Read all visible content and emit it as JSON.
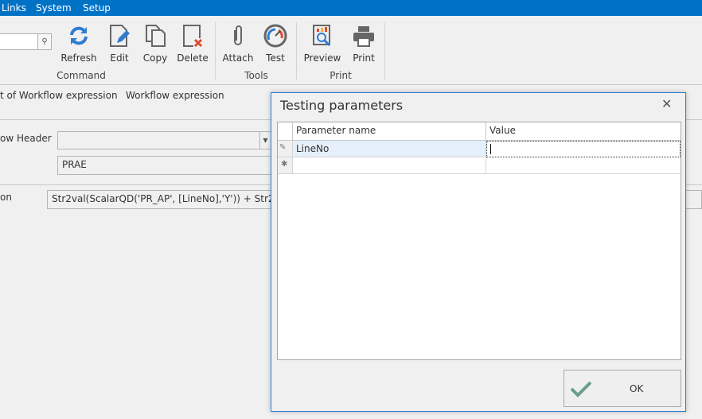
{
  "menu": {
    "items": [
      "Links",
      "System",
      "Setup"
    ]
  },
  "ribbon": {
    "buttons": [
      {
        "label": "Refresh",
        "icon": "refresh-icon"
      },
      {
        "label": "Edit",
        "icon": "edit-icon"
      },
      {
        "label": "Copy",
        "icon": "copy-icon"
      },
      {
        "label": "Delete",
        "icon": "delete-icon"
      },
      {
        "label": "Attach",
        "icon": "paperclip-icon"
      },
      {
        "label": "Test",
        "icon": "gauge-icon"
      },
      {
        "label": "Preview",
        "icon": "preview-icon"
      },
      {
        "label": "Print",
        "icon": "printer-icon"
      }
    ],
    "groups": [
      "Command",
      "Tools",
      "Print"
    ]
  },
  "tabs": [
    "t of Workflow expression",
    "Workflow expression"
  ],
  "form": {
    "header_label": "ow Header",
    "header_value": "",
    "code_value": "PRAE",
    "expr_label": "on",
    "expr_value": "Str2val(ScalarQD('PR_AP', [LineNo],'Y')) + Str2val"
  },
  "dialog": {
    "title": "Testing parameters",
    "columns": [
      "Parameter name",
      "Value"
    ],
    "rows": [
      {
        "name": "LineNo",
        "value": ""
      }
    ],
    "ok_label": "OK",
    "accent": "#2b7cd3"
  }
}
